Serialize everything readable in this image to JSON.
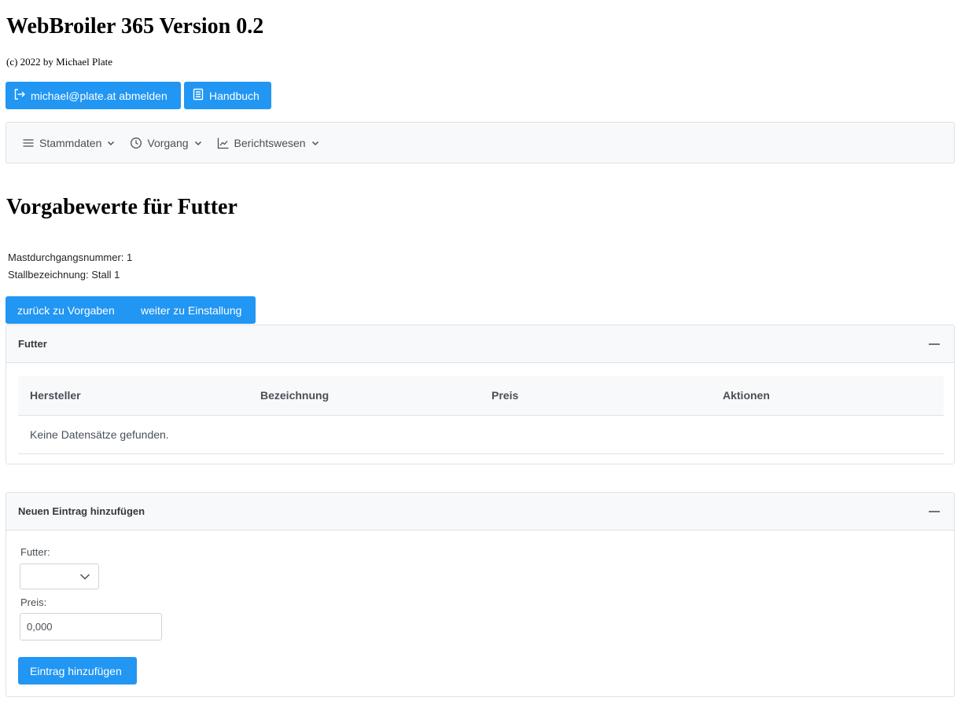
{
  "header": {
    "title": "WebBroiler 365 Version 0.2",
    "copyright": "(c) 2022 by Michael Plate",
    "logout_label": "michael@plate.at abmelden",
    "manual_label": "Handbuch"
  },
  "menu": {
    "items": [
      {
        "label": "Stammdaten",
        "icon": "bars-icon"
      },
      {
        "label": "Vorgang",
        "icon": "clock-icon"
      },
      {
        "label": "Berichtswesen",
        "icon": "chart-line-icon"
      }
    ]
  },
  "page": {
    "title": "Vorgabewerte für Futter",
    "info": [
      "Mastdurchgangsnummer: 1",
      "Stallbezeichnung: Stall 1"
    ],
    "back_label": "zurück zu Vorgaben",
    "next_label": "weiter zu Einstallung"
  },
  "futter_panel": {
    "title": "Futter",
    "columns": [
      "Hersteller",
      "Bezeichnung",
      "Preis",
      "Aktionen"
    ],
    "empty_text": "Keine Datensätze gefunden."
  },
  "new_entry_panel": {
    "title": "Neuen Eintrag hinzufügen",
    "futter_label": "Futter:",
    "futter_value": "",
    "price_label": "Preis:",
    "price_value": "0,000",
    "submit_label": "Eintrag hinzufügen"
  },
  "colors": {
    "primary": "#2196f3",
    "panel_header_bg": "#f8f9fa",
    "border": "#dee2e6"
  }
}
